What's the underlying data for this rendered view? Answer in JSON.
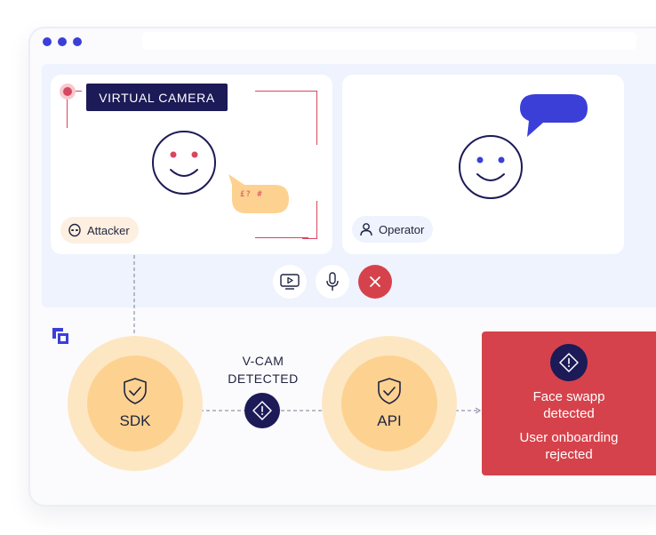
{
  "window": {
    "controls": [
      "dot",
      "dot",
      "dot"
    ],
    "accent": "#3b3fd8"
  },
  "attacker_panel": {
    "camera_label": "VIRTUAL CAMERA",
    "speech_text": "£? #",
    "role_label": "Attacker",
    "role_icon": "alien-icon",
    "frame_color": "#d8465f"
  },
  "operator_panel": {
    "role_label": "Operator",
    "role_icon": "user-icon",
    "bubble_color": "#3b3fd8"
  },
  "call_controls": {
    "screen_share_icon": "screen-play-icon",
    "mic_icon": "microphone-icon",
    "end_call_icon": "close-icon",
    "end_call_color": "#d6424b"
  },
  "flow": {
    "brand_icon": "brand-logo-icon",
    "sdk_label": "SDK",
    "detection_label_line1": "V-CAM",
    "detection_label_line2": "DETECTED",
    "api_label": "API",
    "result": {
      "line1": "Face swapp",
      "line2": "detected",
      "line3": "User onboarding",
      "line4": "rejected",
      "color": "#d6424b"
    }
  }
}
